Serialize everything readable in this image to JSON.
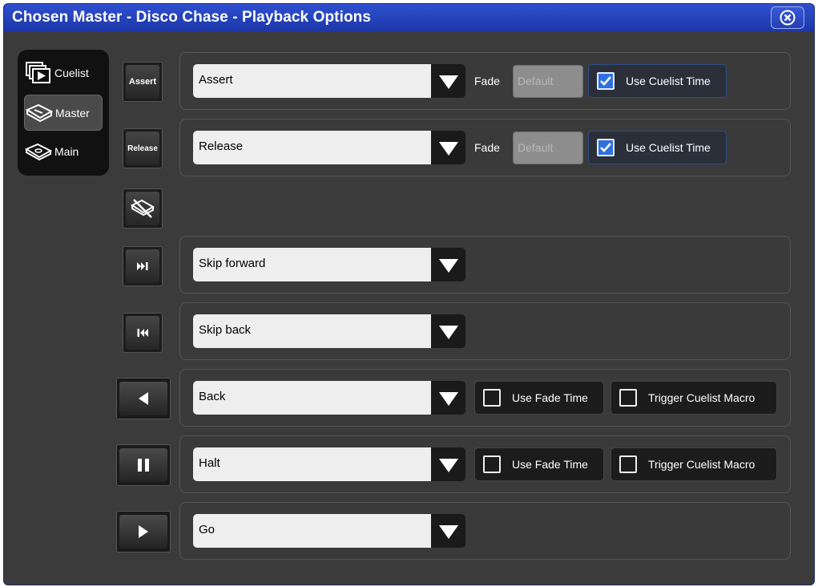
{
  "window": {
    "title": "Chosen Master - Disco Chase - Playback Options"
  },
  "sidebar": {
    "items": [
      {
        "label": "Cuelist",
        "icon": "cuelist-icon"
      },
      {
        "label": "Master",
        "icon": "master-icon",
        "active": true
      },
      {
        "label": "Main",
        "icon": "main-icon"
      }
    ]
  },
  "buttons": {
    "assert": "Assert",
    "release": "Release"
  },
  "rows": {
    "assert": {
      "value": "Assert",
      "fade_label": "Fade",
      "fade_placeholder": "Default",
      "checkbox_label": "Use Cuelist Time",
      "checked": true
    },
    "release": {
      "value": "Release",
      "fade_label": "Fade",
      "fade_placeholder": "Default",
      "checkbox_label": "Use Cuelist Time",
      "checked": true
    },
    "skip_forward": {
      "value": "Skip forward"
    },
    "skip_back": {
      "value": "Skip back"
    },
    "back": {
      "value": "Back",
      "check1_label": "Use Fade Time",
      "check2_label": "Trigger Cuelist Macro"
    },
    "halt": {
      "value": "Halt",
      "check1_label": "Use Fade Time",
      "check2_label": "Trigger Cuelist Macro"
    },
    "go": {
      "value": "Go"
    }
  },
  "colors": {
    "title_bar": "#1d37a8",
    "panel": "#3b3b3b",
    "checkbox_active": "#2d70e0"
  }
}
